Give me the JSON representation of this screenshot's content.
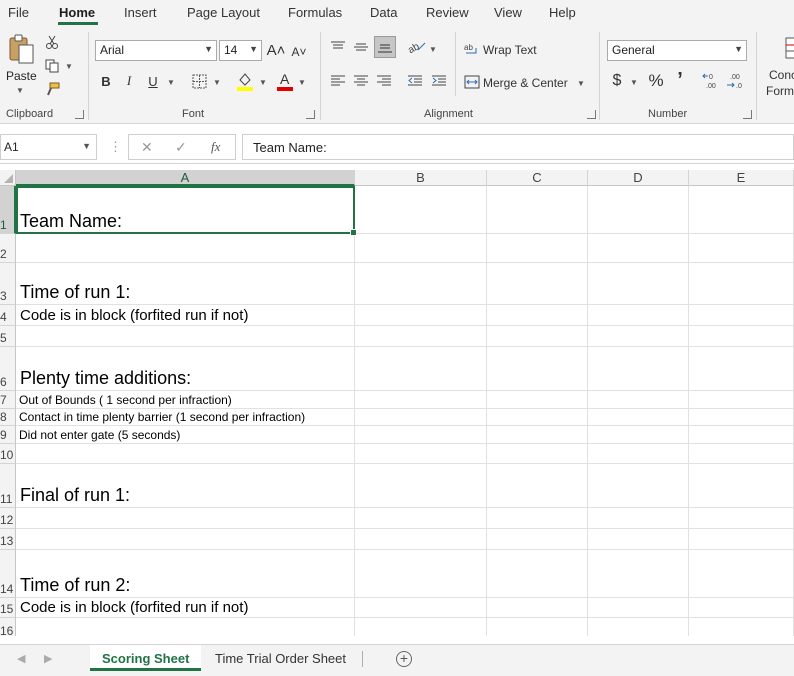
{
  "menu": {
    "tabs": [
      "File",
      "Home",
      "Insert",
      "Page Layout",
      "Formulas",
      "Data",
      "Review",
      "View",
      "Help"
    ],
    "active": "Home"
  },
  "ribbon": {
    "clipboard": {
      "paste_label": "Paste",
      "group_label": "Clipboard"
    },
    "font": {
      "name": "Arial",
      "size": "14",
      "group_label": "Font",
      "bold": "B",
      "italic": "I",
      "underline": "U",
      "grow": "A˄",
      "shrink": "A˅"
    },
    "alignment": {
      "wrap_text": "Wrap Text",
      "merge_center": "Merge & Center",
      "group_label": "Alignment"
    },
    "number": {
      "format": "General",
      "currency": "$",
      "percent": "%",
      "comma": "’",
      "group_label": "Number",
      "inc_decimal": ".00",
      "dec_decimal": ".00"
    },
    "conditional": {
      "line1": "Conc",
      "line2": "Form"
    }
  },
  "formula_bar": {
    "name_box": "A1",
    "fx": "fx",
    "content": "Team Name:"
  },
  "columns": [
    "A",
    "B",
    "C",
    "D",
    "E"
  ],
  "rows": [
    {
      "num": "1",
      "text": "Team Name:"
    },
    {
      "num": "2",
      "text": ""
    },
    {
      "num": "3",
      "text": "Time of run 1:"
    },
    {
      "num": "4",
      "text": "Code is in block (forfited run if not)"
    },
    {
      "num": "5",
      "text": ""
    },
    {
      "num": "6",
      "text": "Plenty time additions:"
    },
    {
      "num": "7",
      "text": "Out of Bounds ( 1 second per infraction)"
    },
    {
      "num": "8",
      "text": "Contact in time plenty barrier (1 second per infraction)"
    },
    {
      "num": "9",
      "text": "Did not enter gate (5 seconds)"
    },
    {
      "num": "10",
      "text": ""
    },
    {
      "num": "11",
      "text": "Final of run 1:"
    },
    {
      "num": "12",
      "text": ""
    },
    {
      "num": "13",
      "text": ""
    },
    {
      "num": "14",
      "text": "Time of run 2:"
    },
    {
      "num": "15",
      "text": "Code is in block (forfited run if not)"
    },
    {
      "num": "16",
      "text": ""
    }
  ],
  "sheets": {
    "tabs": [
      "Scoring Sheet",
      "Time Trial Order Sheet"
    ],
    "active": "Scoring Sheet",
    "add": "+"
  },
  "colors": {
    "accent": "#217346"
  }
}
